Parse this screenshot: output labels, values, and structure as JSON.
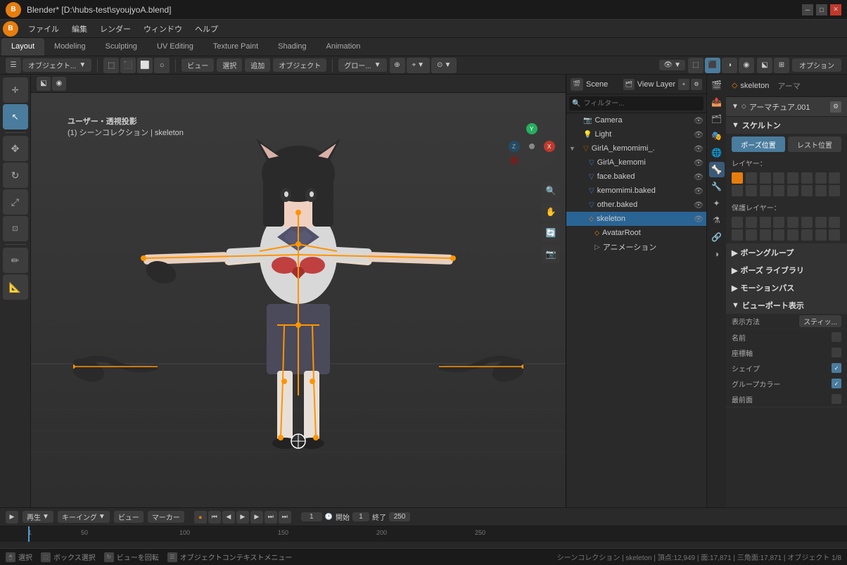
{
  "titlebar": {
    "logo": "B",
    "title": "Blender* [D:\\hubs-test\\syoujyoA.blend]",
    "minimize": "─",
    "maximize": "□",
    "close": "✕"
  },
  "menubar": {
    "items": [
      "ファイル",
      "編集",
      "レンダー",
      "ウィンドウ",
      "ヘルプ"
    ]
  },
  "tabs": {
    "items": [
      "Layout",
      "Modeling",
      "Sculpting",
      "UV Editing",
      "Texture Paint",
      "Shading",
      "Animation"
    ],
    "active": "Layout"
  },
  "viewport_toolbar": {
    "mode": "オブジェクト...",
    "view": "ビュー",
    "select": "選択",
    "add": "追加",
    "object": "オブジェクト",
    "transform": "グロー...",
    "options": "オプション",
    "nav_icons": [
      "🔍",
      "⚙",
      "🔆",
      "🔷"
    ]
  },
  "viewport": {
    "projection": "ユーザー・透視投影",
    "collection": "(1) シーンコレクション | skeleton"
  },
  "scene_bar": {
    "scene_label": "Scene",
    "viewlayer_label": "View Layer"
  },
  "outliner": {
    "items": [
      {
        "name": "Camera",
        "icon": "📷",
        "indent": 1,
        "type": "camera",
        "visible": true
      },
      {
        "name": "Light",
        "icon": "💡",
        "indent": 1,
        "type": "light",
        "visible": true
      },
      {
        "name": "GirlA_kemomimi_.",
        "icon": "▽",
        "indent": 1,
        "type": "armature",
        "visible": true,
        "expanded": true
      },
      {
        "name": "GirlA_kemomi",
        "icon": "▽",
        "indent": 2,
        "type": "mesh",
        "visible": true
      },
      {
        "name": "face.baked",
        "icon": "▽",
        "indent": 2,
        "type": "mesh",
        "visible": true
      },
      {
        "name": "kemomimi.baked",
        "icon": "▽",
        "indent": 2,
        "type": "mesh",
        "visible": true
      },
      {
        "name": "other.baked",
        "icon": "▽",
        "indent": 2,
        "type": "mesh",
        "visible": true
      },
      {
        "name": "skeleton",
        "icon": "⬦",
        "indent": 2,
        "type": "armature",
        "visible": true,
        "active": true
      },
      {
        "name": "AvatarRoot",
        "icon": "⬦",
        "indent": 3,
        "type": "bone",
        "visible": true
      },
      {
        "name": "アニメーション",
        "icon": "▷",
        "indent": 3,
        "type": "anim",
        "visible": true
      }
    ]
  },
  "props_header": {
    "object_name": "skeleton",
    "armature_label": "アーマ"
  },
  "armature_section": {
    "title": "アーマチュア.001",
    "skeleton_label": "スケルトン",
    "pose_position_label": "ポーズ位置",
    "rest_position_label": "レスト位置",
    "layer_label": "レイヤー：",
    "protected_layer_label": "保護レイヤー：",
    "bone_groups_label": "ボーングループ",
    "pose_library_label": "ポーズ ライブラリ",
    "motion_paths_label": "モーションパス",
    "viewport_display_label": "ビューポート表示",
    "display_as_label": "表示方法",
    "display_as_value": "スティッ...",
    "name_label": "名前",
    "axis_label": "座標軸",
    "shapes_label": "シェイプ",
    "group_colors_label": "グループカラー",
    "in_front_label": "最前面"
  },
  "timeline": {
    "playback_btns": [
      "▶",
      "⏮",
      "⏭",
      "⏪",
      "⏩",
      "⏭",
      "⏮"
    ],
    "current_frame": "1",
    "start_label": "開始",
    "start_value": "1",
    "end_label": "終了",
    "end_value": "250",
    "ruler_marks": [
      "1",
      "50",
      "100",
      "150",
      "200",
      "250"
    ]
  },
  "statusbar": {
    "select": "選択",
    "box_select": "ボックス選択",
    "view_rotate": "ビューを回転",
    "context_menu": "オブジェクトコンテキストメニュー",
    "info": "シーンコレクション | skeleton | 頂点:12,949 | 面:17,871 | 三角面:17,871 | オブジェクト 1/8"
  },
  "colors": {
    "accent": "#4a7c9e",
    "orange": "#e87d0d",
    "active_item": "#2a6494",
    "selected_item": "#1f4f6e",
    "bg_dark": "#1a1a1a",
    "bg_mid": "#2a2a2a",
    "bg_light": "#3d3d3d"
  }
}
